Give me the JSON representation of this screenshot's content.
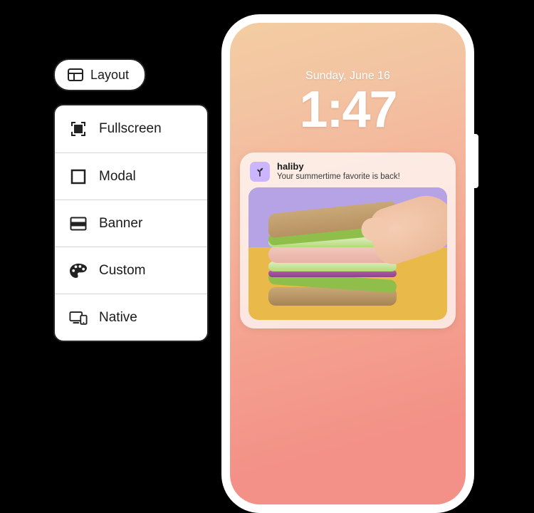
{
  "layout_button": {
    "label": "Layout"
  },
  "options": [
    {
      "key": "fullscreen",
      "label": "Fullscreen"
    },
    {
      "key": "modal",
      "label": "Modal"
    },
    {
      "key": "banner",
      "label": "Banner"
    },
    {
      "key": "custom",
      "label": "Custom"
    },
    {
      "key": "native",
      "label": "Native"
    }
  ],
  "phone": {
    "lock_date": "Sunday, June 16",
    "lock_time": "1:47",
    "notification": {
      "app_name": "haliby",
      "message": "Your summertime favorite is back!"
    }
  }
}
